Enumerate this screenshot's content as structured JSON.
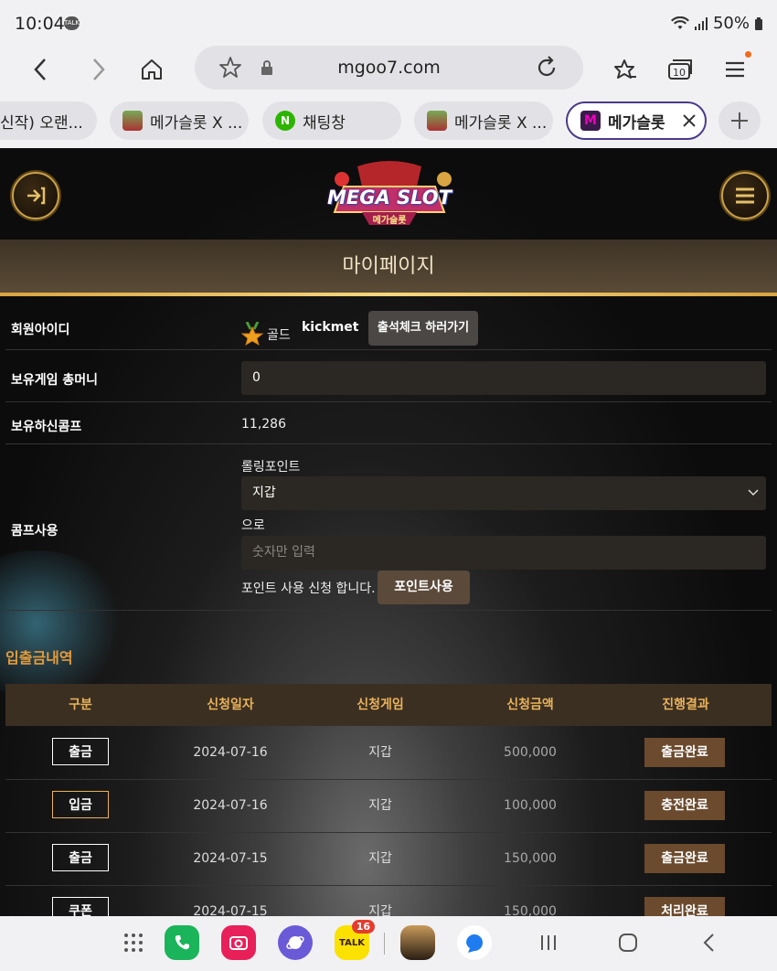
{
  "status_bar": {
    "time": "10:04",
    "talk_badge": "TALK",
    "battery": "50%"
  },
  "browser": {
    "url": "mgoo7.com"
  },
  "tabs": [
    {
      "label": "신작) 오랜..."
    },
    {
      "label": "메가슬롯 X ..."
    },
    {
      "label": "채팅창"
    },
    {
      "label": "메가슬롯 X ..."
    },
    {
      "label": "메가슬롯",
      "active": true
    }
  ],
  "site": {
    "logo_text": "MEGA SLOT",
    "logo_sub": "메가슬롯",
    "page_title": "마이페이지"
  },
  "profile": {
    "id_label": "회원아이디",
    "grade": "골드",
    "user_id": "kickmet",
    "attendance_button": "출석체크 하러가기",
    "money_label": "보유게임 총머니",
    "money_value": "0",
    "comp_label": "보유하신콤프",
    "comp_value": "11,286",
    "comp_use_label": "콤프사용",
    "rolling_label": "롤링포인트",
    "select_value": "지갑",
    "to_label": "으로",
    "amount_placeholder": "숫자만 입력",
    "apply_text": "포인트 사용 신청 합니다.",
    "apply_button": "포인트사용"
  },
  "history": {
    "title": "입출금내역",
    "headers": [
      "구분",
      "신청일자",
      "신청게임",
      "신청금액",
      "진행결과"
    ],
    "rows": [
      {
        "type": "출금",
        "date": "2024-07-16",
        "game": "지갑",
        "amount": "500,000",
        "result": "출금완료"
      },
      {
        "type": "입금",
        "date": "2024-07-16",
        "game": "지갑",
        "amount": "100,000",
        "result": "충전완료"
      },
      {
        "type": "출금",
        "date": "2024-07-15",
        "game": "지갑",
        "amount": "150,000",
        "result": "출금완료"
      },
      {
        "type": "쿠폰",
        "date": "2024-07-15",
        "game": "지갑",
        "amount": "150,000",
        "result": "처리완료"
      }
    ]
  },
  "nav": {
    "talk_badge_count": "16",
    "talk_label": "TALK"
  }
}
